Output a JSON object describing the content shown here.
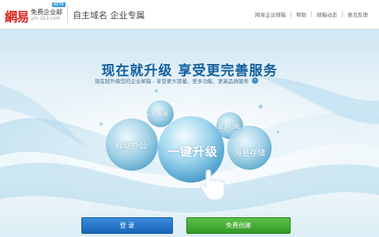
{
  "header": {
    "logo_text": "網易",
    "product": "免费企业邮",
    "domain": "ym.163.com",
    "badge": "BETA",
    "tagline": "自主域名 企业专属",
    "nav": [
      {
        "label": "网易企业邮箱"
      },
      {
        "label": "帮助"
      },
      {
        "label": "邮箱动态"
      },
      {
        "label": "意见反馈"
      }
    ]
  },
  "hero": {
    "headline": "现在就升级 享受更完善服务",
    "subline": "现在就升级您的企业邮箱 - 享受更大容量、更多功能、更高品质服务",
    "subline_arrow_icon": "circle-arrow-right-icon",
    "bubbles": {
      "mobile": "移动办公",
      "cloud": "云存服务",
      "main": "一键升级",
      "features": "更多功能",
      "storage": "海量存储"
    },
    "cursor_icon": "hand-pointer-icon"
  },
  "actions": {
    "login": "登 录",
    "register": "免费创建"
  },
  "colors": {
    "brand_red": "#d8261d",
    "headline_blue": "#125f9c",
    "login_blue": "#1a66b8",
    "register_green": "#2f9a22"
  }
}
